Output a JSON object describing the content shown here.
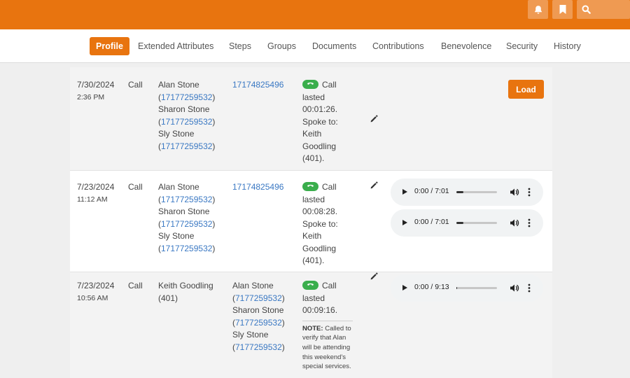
{
  "header": {
    "icons": {
      "bell": "bell-icon",
      "bookmark": "bookmark-icon",
      "search": "search-icon"
    },
    "accent_color": "#e8740f"
  },
  "tabs": [
    {
      "label": "Profile",
      "active": true
    },
    {
      "label": "Extended Attributes",
      "active": false
    },
    {
      "label": "Steps",
      "active": false
    },
    {
      "label": "Groups",
      "active": false
    },
    {
      "label": "Documents",
      "active": false
    },
    {
      "label": "Contributions",
      "active": false
    },
    {
      "label": "Benevolence",
      "active": false
    },
    {
      "label": "Security",
      "active": false
    },
    {
      "label": "History",
      "active": false
    }
  ],
  "rows": [
    {
      "date": "7/30/2024",
      "time": "2:36 PM",
      "type": "Call",
      "from": [
        {
          "name": "Alan Stone",
          "phone": "17177259532"
        },
        {
          "name": "Sharon Stone",
          "phone": "17177259532"
        },
        {
          "name": "Sly Stone",
          "phone": "17177259532"
        }
      ],
      "to": [
        {
          "phone": "17174825496"
        }
      ],
      "summary": [
        "Call",
        "lasted",
        "00:01:26.",
        "Spoke to:",
        "Keith",
        "Goodling",
        "(401)."
      ],
      "note_label": "",
      "note_text": "",
      "load_label": "Load",
      "audio": []
    },
    {
      "date": "7/23/2024",
      "time": "11:12 AM",
      "type": "Call",
      "from": [
        {
          "name": "Alan Stone",
          "phone": "17177259532"
        },
        {
          "name": "Sharon Stone",
          "phone": "17177259532"
        },
        {
          "name": "Sly Stone",
          "phone": "17177259532"
        }
      ],
      "to": [
        {
          "phone": "17174825496"
        }
      ],
      "summary": [
        "Call",
        "lasted",
        "00:08:28.",
        "Spoke to:",
        "Keith",
        "Goodling",
        "(401)."
      ],
      "note_label": "",
      "note_text": "",
      "load_label": "",
      "audio": [
        {
          "time": "0:00 / 7:01",
          "progress": 0.18
        },
        {
          "time": "0:00 / 7:01",
          "progress": 0.18
        }
      ]
    },
    {
      "date": "7/23/2024",
      "time": "10:56 AM",
      "type": "Call",
      "from_text": [
        "Keith Goodling",
        "(401)"
      ],
      "to": [
        {
          "name": "Alan Stone",
          "phone": "7177259532"
        },
        {
          "name": "Sharon Stone",
          "phone": "7177259532"
        },
        {
          "name": "Sly Stone",
          "phone": "7177259532"
        }
      ],
      "summary": [
        "Call",
        "lasted",
        "00:09:16."
      ],
      "note_label": "NOTE:",
      "note_text": "Called to verify that Alan will be attending this weekend's special services.",
      "load_label": "",
      "audio": [
        {
          "time": "0:00 / 9:13",
          "progress": 0.02
        }
      ]
    }
  ]
}
